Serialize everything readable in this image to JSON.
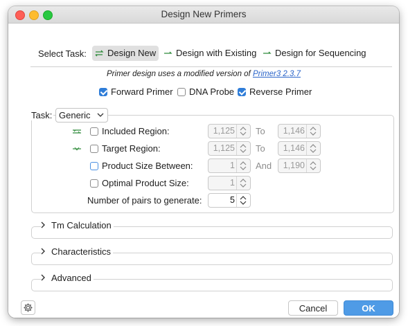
{
  "window": {
    "title": "Design New Primers"
  },
  "tasks": {
    "label": "Select Task:",
    "items": [
      {
        "label": "Design New",
        "active": true
      },
      {
        "label": "Design with Existing",
        "active": false
      },
      {
        "label": "Design for Sequencing",
        "active": false
      }
    ]
  },
  "info": {
    "prefix": "Primer design uses a modified version of ",
    "link": "Primer3 2.3.7"
  },
  "primer_options": [
    {
      "label": "Forward Primer",
      "checked": true
    },
    {
      "label": "DNA Probe",
      "checked": false
    },
    {
      "label": "Reverse Primer",
      "checked": true
    }
  ],
  "task_group": {
    "label": "Task:",
    "selected": "Generic",
    "rows": [
      {
        "label": "Included Region:",
        "from": "1,125",
        "sep": "To",
        "to": "1,146"
      },
      {
        "label": "Target Region:",
        "from": "1,125",
        "sep": "To",
        "to": "1,146"
      },
      {
        "label": "Product Size Between:",
        "from": "1",
        "sep": "And",
        "to": "1,190"
      },
      {
        "label": "Optimal Product Size:",
        "from": "1"
      }
    ],
    "pairs": {
      "label": "Number of pairs to generate:",
      "value": "5"
    }
  },
  "sections": [
    {
      "label": "Tm Calculation"
    },
    {
      "label": "Characteristics"
    },
    {
      "label": "Advanced"
    }
  ],
  "footer": {
    "cancel": "Cancel",
    "ok": "OK"
  },
  "icons": [
    "settings-gear-icon",
    "chevron-right-icon",
    "stepper-arrows-icon",
    "primer-arrow-icon"
  ],
  "colors": {
    "accent": "#2f7dd8",
    "ok_button": "#4f9be6",
    "primer_green": "#2e8b3a",
    "link": "#2a64c9"
  }
}
